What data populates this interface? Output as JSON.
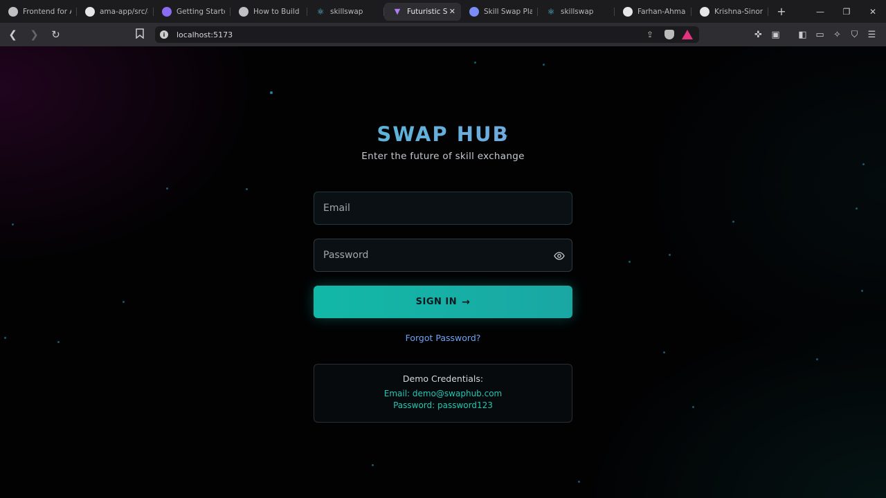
{
  "browser": {
    "tabs": [
      {
        "title": "Frontend for AI",
        "favicon_color": "#bfbfc4"
      },
      {
        "title": "ama-app/src/ap",
        "favicon_color": "#e6e6e6"
      },
      {
        "title": "Getting Started",
        "favicon_color": "#8a6cf0"
      },
      {
        "title": "How to Build a",
        "favicon_color": "#bfbfc4"
      },
      {
        "title": "skillswap",
        "favicon_color": "#5ac8e8"
      },
      {
        "title": "Futuristic S",
        "favicon_color": "#b07cf5",
        "active": true
      },
      {
        "title": "Skill Swap Platf",
        "favicon_color": "#7a8cf5"
      },
      {
        "title": "skillswap",
        "favicon_color": "#5ac8e8"
      },
      {
        "title": "Farhan-Ahmadi",
        "favicon_color": "#e6e6e6"
      },
      {
        "title": "Krishna-Sinoria",
        "favicon_color": "#e6e6e6"
      }
    ],
    "url": "localhost:5173"
  },
  "page": {
    "title": "SWAP HUB",
    "subtitle": "Enter the future of skill exchange",
    "email_placeholder": "Email",
    "password_placeholder": "Password",
    "signin_label": "SIGN IN",
    "forgot_label": "Forgot Password?",
    "demo": {
      "heading": "Demo Credentials:",
      "email_line": "Email: demo@swaphub.com",
      "password_line": "Password: password123"
    }
  },
  "colors": {
    "accent": "#14b8a6",
    "link": "#6fa4f3",
    "background": "#020203"
  }
}
